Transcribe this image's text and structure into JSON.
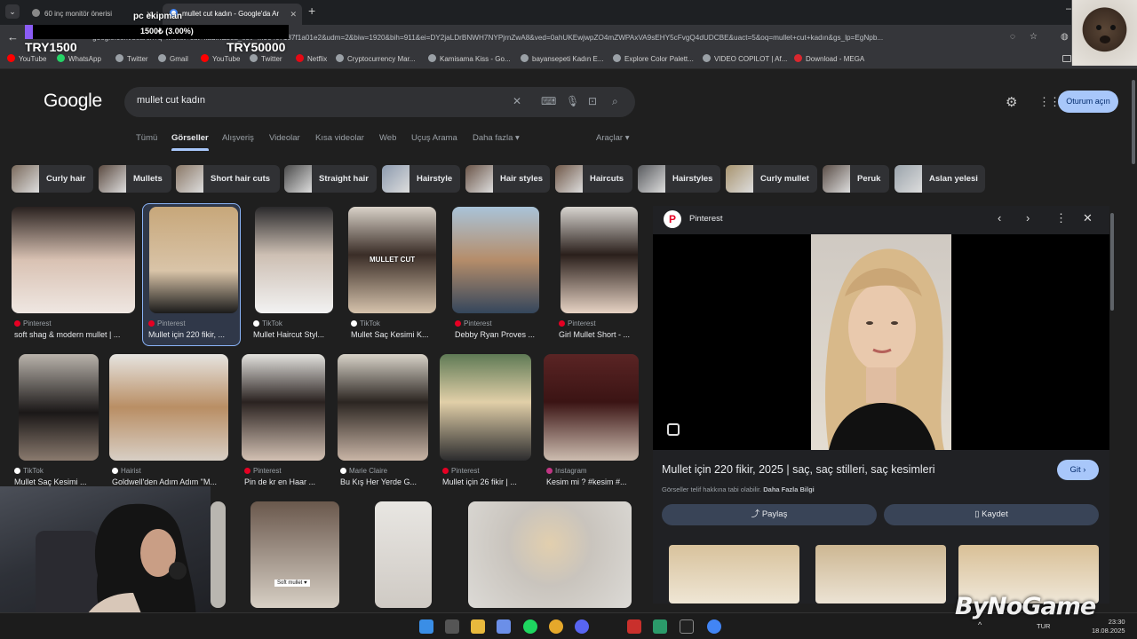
{
  "browser": {
    "tabs": [
      {
        "title": "60 inç monitör önerisi"
      },
      {
        "title": "mullet cut kadın - Google'da Ar"
      }
    ],
    "url": "google.com/search?q=mullet+cut+kadın&sca_esv=...304c7187f1a01e2&udm=2&biw=1920&bih=911&ei=DY2jaLDrBNWH7NYPjrnZwA8&ved=0ahUKEwjwpZO4mZWPAxVA9sEHY5cFvgQ4dUDCBE&uact=5&oq=mullet+cut+kadın&gs_lp=EgNpb...",
    "bookmarks": [
      {
        "label": "YouTube",
        "color": "#ff0000"
      },
      {
        "label": "WhatsApp",
        "color": "#25d366"
      },
      {
        "label": "Twitter",
        "color": "#9aa0a6"
      },
      {
        "label": "Gmail",
        "color": "#9aa0a6"
      },
      {
        "label": "YouTube",
        "color": "#ff0000"
      },
      {
        "label": "Twitter",
        "color": "#9aa0a6"
      },
      {
        "label": "Netflix",
        "color": "#e50914"
      },
      {
        "label": "Cryptocurrency Mar...",
        "color": "#9aa0a6"
      },
      {
        "label": "Kamisama Kiss - Go...",
        "color": "#9aa0a6"
      },
      {
        "label": "bayansepeti Kadın E...",
        "color": "#9aa0a6"
      },
      {
        "label": "Explore Color Palett...",
        "color": "#9aa0a6"
      },
      {
        "label": "VIDEO COPILOT | Af...",
        "color": "#9aa0a6"
      },
      {
        "label": "Download - MEGA",
        "color": "#d9272e"
      }
    ]
  },
  "overlay": {
    "title": "pc ekipman",
    "progress_text": "1500₺ (3.00%)",
    "progress_fraction": 0.03,
    "start": "TRY1500",
    "goal": "TRY50000"
  },
  "google": {
    "logo": "Google",
    "query": "mullet cut kadın",
    "signin": "Oturum açın",
    "nav": [
      "Tümü",
      "Görseller",
      "Alışveriş",
      "Videolar",
      "Kısa videolar",
      "Web",
      "Uçuş Arama",
      "Daha fazla ▾"
    ],
    "tools": "Araçlar ▾",
    "chips": [
      "Curly hair",
      "Mullets",
      "Short hair cuts",
      "Straight hair",
      "Hairstyle",
      "Hair styles",
      "Haircuts",
      "Hairstyles",
      "Curly mullet",
      "Peruk",
      "Aslan yelesi"
    ]
  },
  "results": [
    {
      "source": "Pinterest",
      "caption": "soft shag & modern mullet | ...",
      "color": "#e60023"
    },
    {
      "source": "Pinterest",
      "caption": "Mullet için 220 fikir, ...",
      "color": "#e60023"
    },
    {
      "source": "TikTok",
      "caption": "Mullet Haircut Styl...",
      "color": "#ffffff"
    },
    {
      "source": "TikTok",
      "caption": "Mullet Saç Kesimi K...",
      "color": "#ffffff"
    },
    {
      "source": "Pinterest",
      "caption": "Debby Ryan Proves ...",
      "color": "#e60023"
    },
    {
      "source": "Pinterest",
      "caption": "Girl Mullet Short - ...",
      "color": "#e60023"
    },
    {
      "source": "TikTok",
      "caption": "Mullet Saç Kesimi ...",
      "color": "#ffffff"
    },
    {
      "source": "Hairist",
      "caption": "Goldwell'den Adım Adım \"M...",
      "color": "#ffffff"
    },
    {
      "source": "Pinterest",
      "caption": "Pin de kr en Haar ...",
      "color": "#e60023"
    },
    {
      "source": "Marie Claire",
      "caption": "Bu Kış Her Yerde G...",
      "color": "#ffffff"
    },
    {
      "source": "Pinterest",
      "caption": "Mullet için 26 fikir | ...",
      "color": "#e60023"
    },
    {
      "source": "Instagram",
      "caption": "Kesim mi ? #kesim #...",
      "color": "#c13584"
    }
  ],
  "image_overlay_text": {
    "mullet_cut": "MULLET CUT",
    "soft_mullet": "Soft mullet ♥"
  },
  "preview": {
    "source": "Pinterest",
    "title": "Mullet için 220 fikir, 2025 | saç, saç stilleri, saç kesimleri",
    "visit": "Git ›",
    "note": "Görseller telif hakkına tabi olabilir.",
    "note_link": "Daha Fazla Bilgi",
    "share": "Paylaş",
    "save": "Kaydet"
  },
  "taskbar": {
    "lang": "TUR",
    "time": "23:30",
    "date": "18.08.2025"
  },
  "watermark": "ByNoGame"
}
